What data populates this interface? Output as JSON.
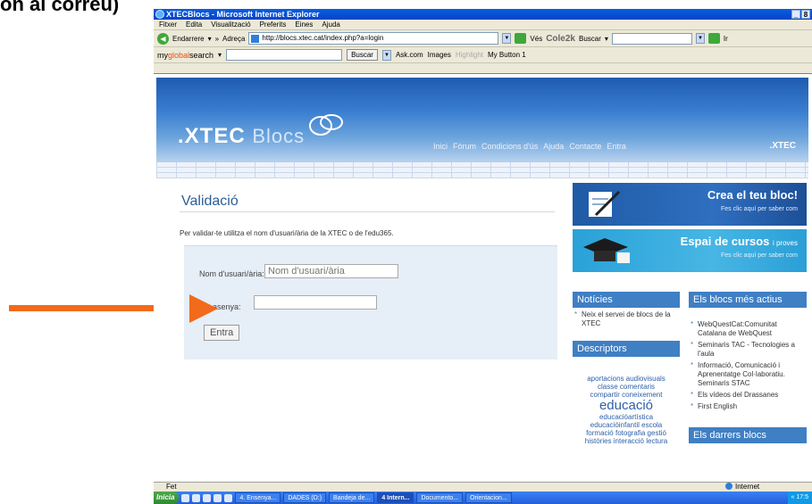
{
  "annotation": {
    "caption": "on al correu)"
  },
  "browser": {
    "title": "XTECBlocs - Microsoft Internet Explorer",
    "btn_min": "_",
    "btn_max": "8",
    "menu": [
      "Fitxer",
      "Edita",
      "Visualització",
      "Preferits",
      "Eines",
      "Ajuda"
    ],
    "back": "Endarrere",
    "overflow": "»",
    "address_label": "Adreça",
    "url": "http://blocs.xtec.cat/index.php?a=login",
    "go": "Vés",
    "cole": "Cole2k",
    "cole_search": "Buscar",
    "cole_go": "Ir",
    "mgs_a": "my",
    "mgs_b": "global",
    "mgs_c": "search",
    "buscar": "Buscar",
    "ask": "Ask.com",
    "images": "Images",
    "highlight": "Highlight",
    "mybutton": "My Button 1",
    "status": "Fet",
    "zone": "Internet"
  },
  "site": {
    "logo_xtec": ".XTEC ",
    "logo_blocs": "Blocs",
    "nav": [
      "Inici",
      "Fòrum",
      "Condicions d'ús",
      "Ajuda",
      "Contacte",
      "Entra"
    ],
    "xtec_small": ".XTEC"
  },
  "login": {
    "title": "Validació",
    "description": "Per validar-te utilitza el nom d'usuari/ària de la XTEC o de l'edu365.",
    "username_label": "Nom d'usuari/ària:",
    "username_placeholder": "Nom d'usuari/ària",
    "password_label": "asenya:",
    "submit": "Entra"
  },
  "sidebar": {
    "promo1_title": "Crea el teu bloc!",
    "promo1_sub": "Fes clic aquí per saber com",
    "promo2_title": "Espai de cursos ",
    "promo2_tag": "i proves",
    "promo2_sub": "Fes clic aquí per saber com",
    "news_title": "Notícies",
    "news": [
      "Neix el servei de blocs de la XTEC"
    ],
    "descriptors_title": "Descriptors",
    "tags": [
      "aportacions audiovisuals",
      "classe comentaris",
      "compartir coneixement",
      "educació",
      "educacióartística",
      "educacióinfantil escola",
      "formació fotografia gestió",
      "històries interacció lectura"
    ],
    "active_title": "Els blocs més actius",
    "active": [
      "WebQuestCat:Comunitat Catalana de WebQuest",
      "Seminaris TAC - Tecnologies a l'aula",
      "Informació, Comunicació i Aprenentatge Col·laboratiu. Seminaris STAC",
      "Els vídeos del Drassanes",
      "First English"
    ],
    "latest_title": "Els darrers blocs"
  },
  "taskbar": {
    "start": "Inicia",
    "items": [
      "4. Ensenya...",
      "DADES (D:)",
      "Bandeja de...",
      "4 Intern...",
      "Documento...",
      "Orientacion..."
    ],
    "clock": "« 17:5"
  }
}
